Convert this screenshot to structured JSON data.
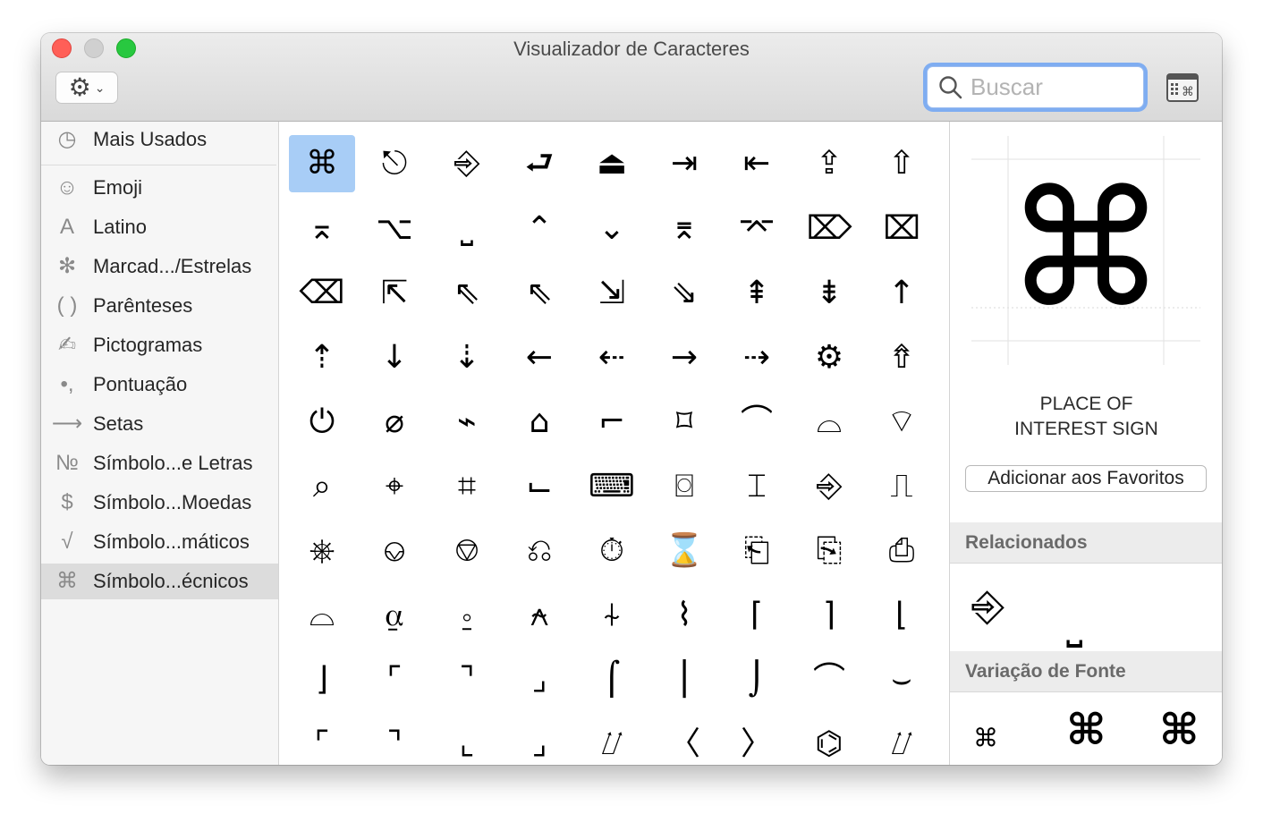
{
  "window": {
    "title": "Visualizador de Caracteres"
  },
  "toolbar": {
    "action_icon": "gear-icon",
    "dropdown_icon": "chevron-down-icon",
    "keyboard_icon": "keyboard-viewer-icon"
  },
  "search": {
    "placeholder": "Buscar",
    "value": ""
  },
  "sidebar": {
    "items": [
      {
        "label": "Mais Usados",
        "icon": "clock-icon",
        "glyph": "◷"
      },
      {
        "label": "Emoji",
        "icon": "smiley-icon",
        "glyph": "☺"
      },
      {
        "label": "Latino",
        "icon": "latin-a-icon",
        "glyph": "A"
      },
      {
        "label": "Marcad.../Estrelas",
        "icon": "asterisk-icon",
        "glyph": "✻"
      },
      {
        "label": "Parênteses",
        "icon": "parentheses-icon",
        "glyph": "( )"
      },
      {
        "label": "Pictogramas",
        "icon": "pencil-icon",
        "glyph": "✍"
      },
      {
        "label": "Pontuação",
        "icon": "quote-icon",
        "glyph": "•,",
        "note": ""
      },
      {
        "label": "Setas",
        "icon": "arrow-icon",
        "glyph": "⟶"
      },
      {
        "label": "Símbolo...e Letras",
        "icon": "numero-icon",
        "glyph": "№"
      },
      {
        "label": "Símbolo...Moedas",
        "icon": "dollar-icon",
        "glyph": "$"
      },
      {
        "label": "Símbolo...máticos",
        "icon": "square-root-icon",
        "glyph": "√"
      },
      {
        "label": "Símbolo...écnicos",
        "icon": "command-icon",
        "glyph": "⌘",
        "selected": true
      }
    ]
  },
  "grid": {
    "selected_index": 0,
    "rows": [
      [
        "⌘",
        "⎋",
        "⎆",
        "⮐",
        "⏏",
        "⇥",
        "⇤",
        "⇪",
        "⇧"
      ],
      [
        "⌅",
        "⌥",
        "⎵",
        "⌃",
        "⌄",
        "⌆",
        "⌤",
        "⌦",
        "⌧"
      ],
      [
        "⌫",
        "⇱",
        "⇖",
        "⇖",
        "⇲",
        "⇘",
        "⇞",
        "⇟",
        "↑"
      ],
      [
        "⇡",
        "↓",
        "⇣",
        "←",
        "⇠",
        "→",
        "⇢",
        "⚙",
        "⇮"
      ],
      [
        "⏻",
        "⌀",
        "⌁",
        "⌂",
        "⌐",
        "⌑",
        "⌒",
        "⌓",
        "⌔"
      ],
      [
        "⌕",
        "⌖",
        "⌗",
        "⌙",
        "⌨",
        "⌼",
        "⌶",
        "⎆",
        "⎍"
      ],
      [
        "⎈",
        "⎉",
        "⎊",
        "⎌",
        "⏱",
        "⌛",
        "⎗",
        "⎘",
        "⎙"
      ],
      [
        "⌓",
        "⍶",
        "⍛",
        "⍲",
        "⍭",
        "⌇",
        "⌈",
        "⌉",
        "⌊"
      ],
      [
        "⌋",
        "⌜",
        "⌝",
        "⌟",
        "⌠",
        "⎪",
        "⌡",
        "⌒",
        "⌣"
      ],
      [
        "⌜",
        "⌝",
        "⌞",
        "⌟",
        "⌰",
        "〈",
        "〉",
        "⌬",
        "⌰"
      ]
    ]
  },
  "detail": {
    "glyph": "⌘",
    "name_line1": "PLACE OF",
    "name_line2": "INTEREST SIGN",
    "favorites_label": "Adicionar aos Favoritos",
    "related_header": "Relacionados",
    "related": [
      "⎆",
      "⎵"
    ],
    "variation_header": "Variação de Fonte",
    "variations": [
      "⌘",
      "⌘",
      "⌘"
    ]
  }
}
